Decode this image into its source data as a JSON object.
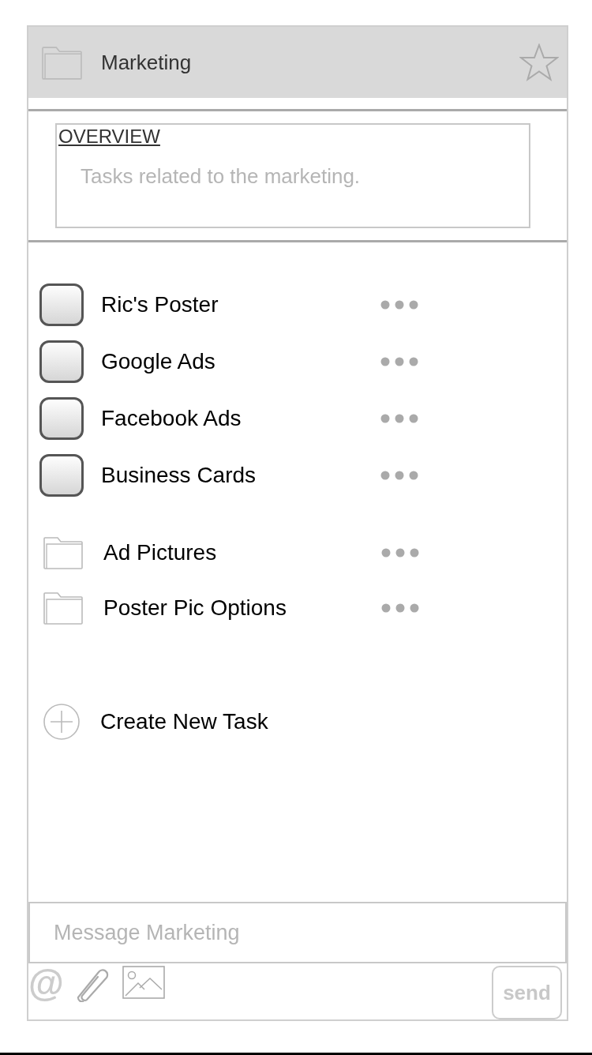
{
  "header": {
    "title": "Marketing"
  },
  "overview": {
    "label": "OVERVIEW",
    "text": "Tasks related to the marketing."
  },
  "items": [
    {
      "kind": "task",
      "label": "Ric's Poster",
      "checked": false
    },
    {
      "kind": "task",
      "label": "Google Ads",
      "checked": false
    },
    {
      "kind": "task",
      "label": "Facebook Ads",
      "checked": false
    },
    {
      "kind": "task",
      "label": "Business Cards",
      "checked": false
    },
    {
      "kind": "folder",
      "label": "Ad Pictures"
    },
    {
      "kind": "folder",
      "label": "Poster Pic Options"
    }
  ],
  "create": {
    "label": "Create New Task"
  },
  "composer": {
    "placeholder": "Message Marketing",
    "mention": "@",
    "send": "send"
  }
}
